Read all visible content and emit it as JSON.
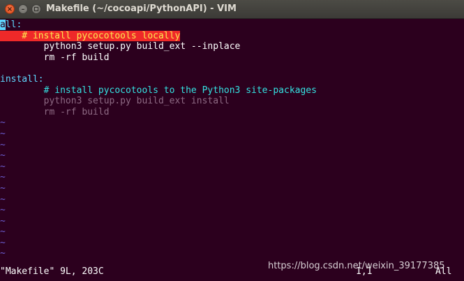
{
  "window": {
    "title": "Makefile (~/cocoapi/PythonAPI) - VIM",
    "close_glyph": "×",
    "min_glyph": "–"
  },
  "editor": {
    "lines": {
      "l1_cursor": "a",
      "l1_rest": "ll:",
      "l2": "    # install pycocotools locally",
      "l3": "        python3 setup.py build_ext --inplace",
      "l4": "        rm -rf build",
      "l6": "install:",
      "l7": "        # install pycocotools to the Python3 site-packages",
      "l8": "        python3 setup.py build_ext install",
      "l9": "        rm -rf build"
    },
    "tilde": "~"
  },
  "status": {
    "file_info": "\"Makefile\" 9L, 203C",
    "position": "1,1",
    "scroll": "All"
  },
  "watermark": "https://blog.csdn.net/weixin_39177385",
  "colors": {
    "background": "#2c001e",
    "label": "#5fd7ff",
    "highlight_bg": "#ef2929",
    "highlight_fg": "#fce94f",
    "comment": "#34e2e2",
    "tilde": "#6b5cd0"
  }
}
